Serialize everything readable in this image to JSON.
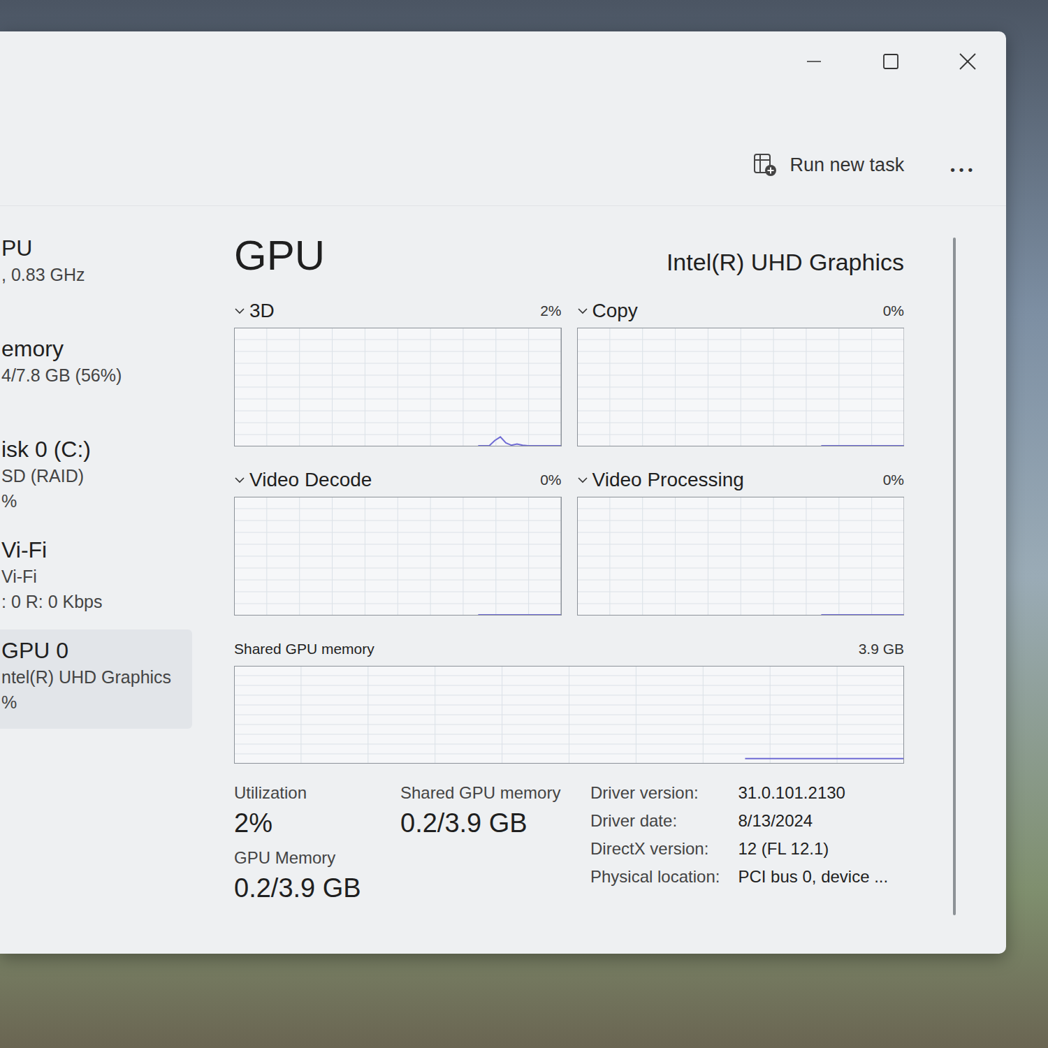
{
  "toolbar": {
    "run_new_task": "Run new task",
    "more": "•••"
  },
  "sidebar": {
    "items": [
      {
        "title": "PU",
        "lines": [
          ", 0.83 GHz"
        ],
        "selected": false
      },
      {
        "title": "emory",
        "lines": [
          "4/7.8 GB (56%)"
        ],
        "selected": false
      },
      {
        "title": "isk 0 (C:)",
        "lines": [
          "SD (RAID)",
          "%"
        ],
        "selected": false
      },
      {
        "title": "Vi-Fi",
        "lines": [
          "Vi-Fi",
          ": 0 R: 0 Kbps"
        ],
        "selected": false
      },
      {
        "title": "GPU 0",
        "lines": [
          "ntel(R) UHD Graphics",
          "%"
        ],
        "selected": true
      }
    ]
  },
  "panel": {
    "title": "GPU",
    "device": "Intel(R) UHD Graphics"
  },
  "graphs": [
    {
      "label": "3D",
      "reading": "2%",
      "expanded": true,
      "axis_max": 100,
      "values": [
        0,
        0,
        0,
        5,
        8,
        3,
        1,
        2,
        1,
        0,
        0,
        0,
        0,
        0,
        0,
        0
      ]
    },
    {
      "label": "Copy",
      "reading": "0%",
      "expanded": true,
      "axis_max": 100,
      "values": [
        0,
        0,
        0,
        0,
        0,
        0,
        0,
        0,
        0,
        0,
        0,
        0,
        0,
        0,
        0,
        0
      ]
    },
    {
      "label": "Video Decode",
      "reading": "0%",
      "expanded": true,
      "axis_max": 100,
      "values": [
        0,
        0,
        0,
        0,
        0,
        0,
        0,
        0,
        0,
        0,
        0,
        0,
        0,
        0,
        0,
        0
      ]
    },
    {
      "label": "Video Processing",
      "reading": "0%",
      "expanded": true,
      "axis_max": 100,
      "values": [
        0,
        0,
        0,
        0,
        0,
        0,
        0,
        0,
        0,
        0,
        0,
        0,
        0,
        0,
        0,
        0
      ]
    }
  ],
  "shared_memory_chart": {
    "label": "Shared GPU memory",
    "reading": "3.9 GB",
    "axis_max": 3.9,
    "values": [
      0.2,
      0.2,
      0.2,
      0.2,
      0.2,
      0.2,
      0.2,
      0.2,
      0.2,
      0.2,
      0.2,
      0.2,
      0.2,
      0.2,
      0.2
    ]
  },
  "stats": [
    {
      "label": "Utilization",
      "value": "2%"
    },
    {
      "label": "GPU Memory",
      "value": "0.2/3.9 GB"
    },
    {
      "label": "Shared GPU memory",
      "value": "0.2/3.9 GB"
    }
  ],
  "details": [
    {
      "label": "Driver version:",
      "value": "31.0.101.2130"
    },
    {
      "label": "Driver date:",
      "value": "8/13/2024"
    },
    {
      "label": "DirectX version:",
      "value": "12 (FL 12.1)"
    },
    {
      "label": "Physical location:",
      "value": "PCI bus 0, device ..."
    }
  ]
}
